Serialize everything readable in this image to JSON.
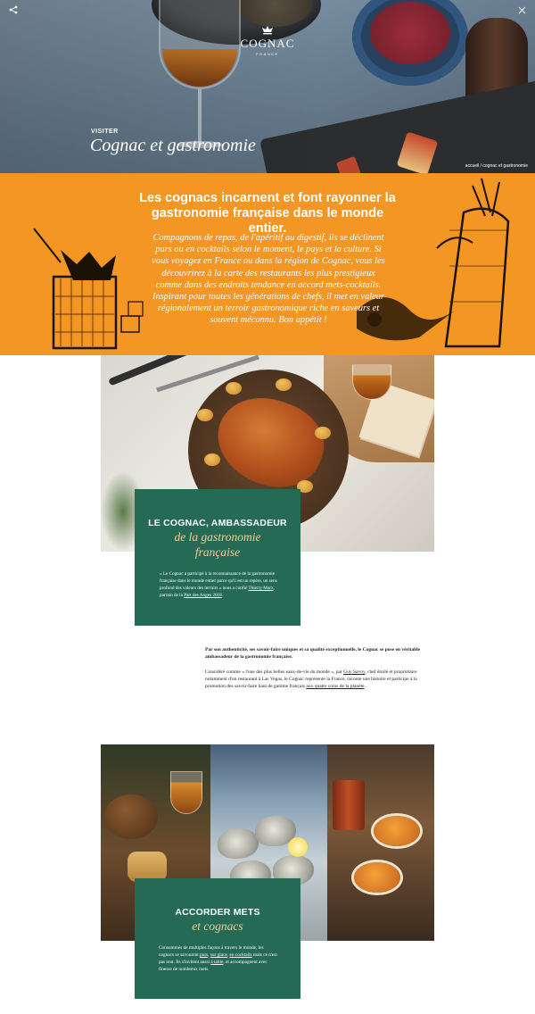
{
  "brand": {
    "logo_word": "COGNAC",
    "logo_country": "FRANCE",
    "accent": "#f39623",
    "green": "#246a55",
    "gold": "#f1cf96"
  },
  "toolbar": {
    "share_icon": "share-icon",
    "close_icon": "close-icon"
  },
  "hero": {
    "eyebrow": "VISITER",
    "title": "Cognac et gastronomie",
    "breadcrumb": "accueil / cognac et gastronomie"
  },
  "intro": {
    "title": "Les cognacs incarnent et font rayonner la gastronomie française dans le monde entier.",
    "text": "Compagnons de repas, de l'apéritif au digestif, ils se déclinent purs ou en cocktails selon le moment, le pays et la culture. Si vous voyagez en France ou dans la région de Cognac, vous les découvrirez à la carte des restaurants les plus prestigieux comme dans des endroits tendance en accord mets-cocktails. Inspirant pour toutes les générations de chefs, il met en valeur régionalement un terroir gastronomique riche en saveurs et souvent méconnu. Bon appétit !"
  },
  "section1": {
    "title": "LE COGNAC, AMBASSADEUR",
    "subtitle_line1": "de la gastronomie",
    "subtitle_line2": "française",
    "quote_start": "« Le Cognac a participé à la reconnaissance de la gastronomie française dans le monde entier parce qu'il est un repère, un sens profond des valeurs des terroirs » nous a confié ",
    "quote_link1": "Thierry Marx",
    "quote_mid": ", parrain de la ",
    "quote_link2": "Part des Anges 2018",
    "quote_end": ".",
    "lead": "Par son authenticité, ses savoir-faire uniques et sa qualité exceptionnelle, le Cognac se pose en véritable ambassadeur de la gastronomie française.",
    "body_start": "Considéré comme «  l'une des plus belles eaux-de-vie du monde », par ",
    "body_link1": "Guy Savoy",
    "body_mid": ", chef étoilé et propriétaire notamment d'un restaurant à Las Vegas, le Cognac représente la France, raconte une histoire et participe à la promotion des savoir-faire haut de gamme français ",
    "body_link2": "aux quatre coins de la planète",
    "body_end": "."
  },
  "section2": {
    "title": "ACCORDER METS",
    "subtitle": "et cognacs",
    "body_start": "Consommés de multiples façons à travers le monde, les cognacs se savourent ",
    "link1": "purs",
    "sep1": ", ",
    "link2": "sur glace",
    "sep2": ", ",
    "link3": "en cocktails",
    "body_mid": " mais ce n'est pas tout. Ils s'invitent aussi ",
    "link4": "à table",
    "body_end": ", et accompagnent avec finesse de nombreux mets."
  }
}
